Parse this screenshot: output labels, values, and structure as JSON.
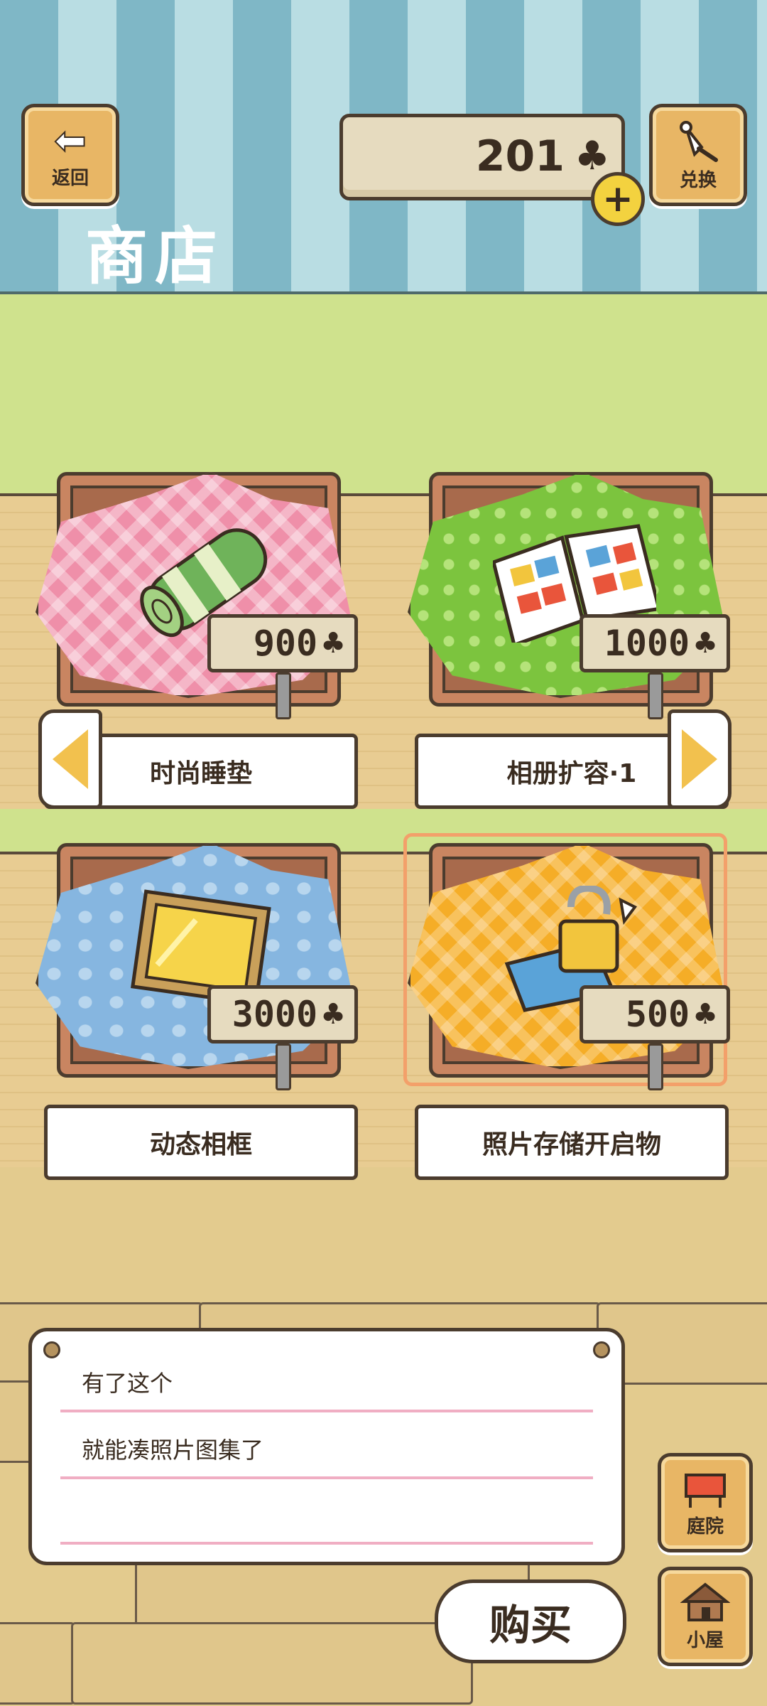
{
  "header": {
    "back_label": "返回",
    "title": "商店",
    "coin_count": "201",
    "currency_symbol": "♣",
    "plus_symbol": "+",
    "exchange_label": "兑换"
  },
  "items": [
    {
      "name": "时尚睡垫",
      "price": "900",
      "cloth": "pink"
    },
    {
      "name": "相册扩容·1",
      "price": "1000",
      "cloth": "green"
    },
    {
      "name": "动态相框",
      "price": "3000",
      "cloth": "blue"
    },
    {
      "name": "照片存储开启物",
      "price": "500",
      "cloth": "orange",
      "selected": true
    }
  ],
  "message": {
    "line1": "有了这个",
    "line2": "就能凑照片图集了"
  },
  "actions": {
    "buy_label": "购买",
    "yard_label": "庭院",
    "house_label": "小屋"
  }
}
